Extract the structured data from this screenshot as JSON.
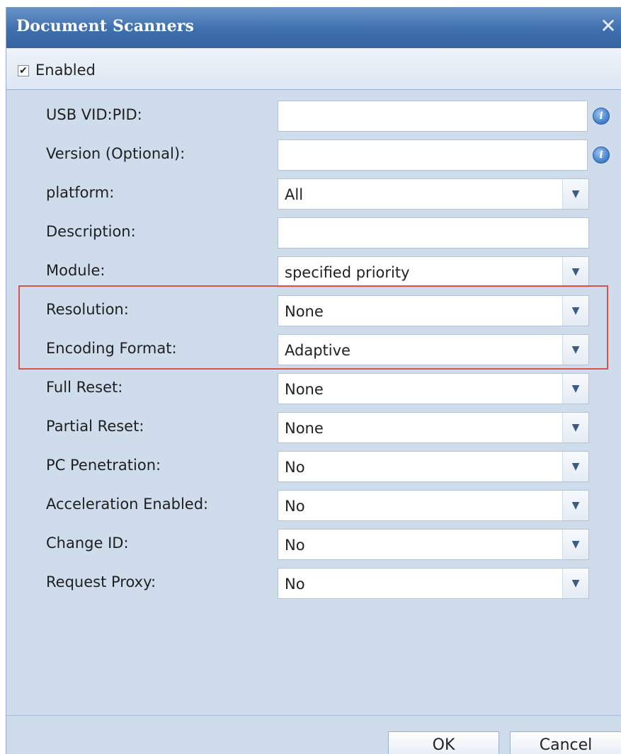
{
  "dialog": {
    "title": "Document Scanners",
    "close_glyph": "✕"
  },
  "toolbar": {
    "enabled_checked": true,
    "enabled_label": "Enabled"
  },
  "fields": {
    "usb_vid_pid": {
      "label": "USB VID:PID:",
      "value": ""
    },
    "version": {
      "label": "Version (Optional):",
      "value": ""
    },
    "platform": {
      "label": "platform:",
      "value": "All"
    },
    "description": {
      "label": "Description:",
      "value": ""
    },
    "module": {
      "label": "Module:",
      "value": "specified priority"
    },
    "resolution": {
      "label": "Resolution:",
      "value": "None"
    },
    "encoding_format": {
      "label": "Encoding Format:",
      "value": "Adaptive"
    },
    "full_reset": {
      "label": "Full Reset:",
      "value": "None"
    },
    "partial_reset": {
      "label": "Partial Reset:",
      "value": "None"
    },
    "pc_penetration": {
      "label": "PC Penetration:",
      "value": "No"
    },
    "acceleration_enabled": {
      "label": "Acceleration Enabled:",
      "value": "No"
    },
    "change_id": {
      "label": "Change ID:",
      "value": "No"
    },
    "request_proxy": {
      "label": "Request Proxy:",
      "value": "No"
    }
  },
  "icons": {
    "info": "info-icon",
    "dropdown": "chevron-down-icon",
    "close": "close-icon",
    "check": "checkmark-icon"
  },
  "buttons": {
    "ok": "OK",
    "cancel": "Cancel"
  },
  "colors": {
    "title_bar": "#3e6fae",
    "panel_background": "#cedcec",
    "highlight_border": "#d9534f"
  }
}
